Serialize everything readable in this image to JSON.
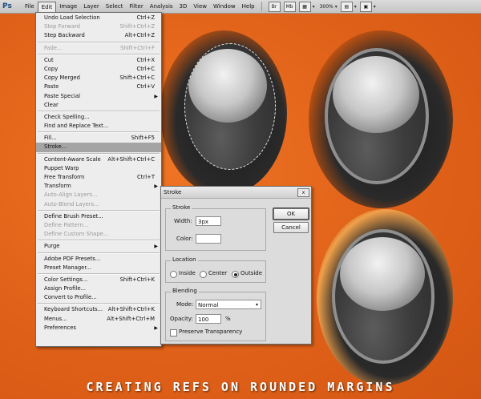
{
  "menubar": {
    "logo": "Ps",
    "menus": [
      "File",
      "Edit",
      "Image",
      "Layer",
      "Select",
      "Filter",
      "Analysis",
      "3D",
      "View",
      "Window",
      "Help"
    ],
    "active": "Edit",
    "toolbar": {
      "br": "Br",
      "mb": "Mb",
      "zoom": "300%"
    }
  },
  "edit_menu": [
    {
      "label": "Undo Load Selection",
      "shortcut": "Ctrl+Z"
    },
    {
      "label": "Step Forward",
      "shortcut": "Shift+Ctrl+Z",
      "disabled": true
    },
    {
      "label": "Step Backward",
      "shortcut": "Alt+Ctrl+Z"
    },
    {
      "sep": true
    },
    {
      "label": "Fade...",
      "shortcut": "Shift+Ctrl+F",
      "disabled": true
    },
    {
      "sep": true
    },
    {
      "label": "Cut",
      "shortcut": "Ctrl+X"
    },
    {
      "label": "Copy",
      "shortcut": "Ctrl+C"
    },
    {
      "label": "Copy Merged",
      "shortcut": "Shift+Ctrl+C"
    },
    {
      "label": "Paste",
      "shortcut": "Ctrl+V"
    },
    {
      "label": "Paste Special",
      "submenu": true
    },
    {
      "label": "Clear"
    },
    {
      "sep": true
    },
    {
      "label": "Check Spelling..."
    },
    {
      "label": "Find and Replace Text..."
    },
    {
      "sep": true
    },
    {
      "label": "Fill...",
      "shortcut": "Shift+F5"
    },
    {
      "label": "Stroke...",
      "highlighted": true
    },
    {
      "sep": true
    },
    {
      "label": "Content-Aware Scale",
      "shortcut": "Alt+Shift+Ctrl+C"
    },
    {
      "label": "Puppet Warp"
    },
    {
      "label": "Free Transform",
      "shortcut": "Ctrl+T"
    },
    {
      "label": "Transform",
      "submenu": true
    },
    {
      "label": "Auto-Align Layers...",
      "disabled": true
    },
    {
      "label": "Auto-Blend Layers...",
      "disabled": true
    },
    {
      "sep": true
    },
    {
      "label": "Define Brush Preset..."
    },
    {
      "label": "Define Pattern...",
      "disabled": true
    },
    {
      "label": "Define Custom Shape...",
      "disabled": true
    },
    {
      "sep": true
    },
    {
      "label": "Purge",
      "submenu": true
    },
    {
      "sep": true
    },
    {
      "label": "Adobe PDF Presets..."
    },
    {
      "label": "Preset Manager..."
    },
    {
      "sep": true
    },
    {
      "label": "Color Settings...",
      "shortcut": "Shift+Ctrl+K"
    },
    {
      "label": "Assign Profile..."
    },
    {
      "label": "Convert to Profile..."
    },
    {
      "sep": true
    },
    {
      "label": "Keyboard Shortcuts...",
      "shortcut": "Alt+Shift+Ctrl+K"
    },
    {
      "label": "Menus...",
      "shortcut": "Alt+Shift+Ctrl+M"
    },
    {
      "label": "Preferences",
      "submenu": true
    }
  ],
  "dialog": {
    "title": "Stroke",
    "close": "x",
    "stroke_group": "Stroke",
    "width_label": "Width:",
    "width_value": "3px",
    "color_label": "Color:",
    "location_group": "Location",
    "loc_inside": "Inside",
    "loc_center": "Center",
    "loc_outside": "Outside",
    "blending_group": "Blending",
    "mode_label": "Mode:",
    "mode_value": "Normal",
    "opacity_label": "Opacity:",
    "opacity_value": "100",
    "opacity_unit": "%",
    "preserve_label": "Preserve Transparency",
    "ok": "OK",
    "cancel": "Cancel"
  },
  "caption": "CREATING REFS ON ROUNDED MARGINS"
}
